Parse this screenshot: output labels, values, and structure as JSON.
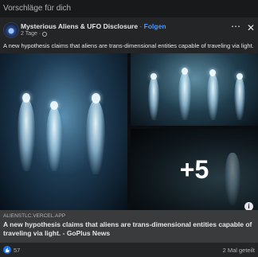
{
  "feed": {
    "section_label": "Vorschläge für dich"
  },
  "post": {
    "page_name": "Mysterious Aliens & UFO Disclosure",
    "separator": "·",
    "follow_label": "Folgen",
    "time": "2 Tage",
    "time_separator": "·",
    "privacy_icon": "globe-icon",
    "more_icon": "more-options-icon",
    "more_glyph": "⋯",
    "close_icon": "close-icon",
    "close_glyph": "✕",
    "text": "A new hypothesis claims that aliens are trans-dimensional entities capable of traveling via light.",
    "media": {
      "more_count": "+5",
      "info_icon": "info-icon",
      "info_glyph": "i"
    },
    "link": {
      "domain": "ALIENSTLC.VERCEL.APP",
      "title": "A new hypothesis claims that aliens are trans-dimensional entities capable of traveling via light. - GoPlus News"
    },
    "reactions": {
      "like_icon": "like-icon",
      "count": "57",
      "shares": "2 Mal geteilt"
    }
  },
  "colors": {
    "background": "#18191a",
    "card": "#242526",
    "link_preview": "#3a3b3c",
    "accent": "#4599ff",
    "like": "#1877f2"
  }
}
